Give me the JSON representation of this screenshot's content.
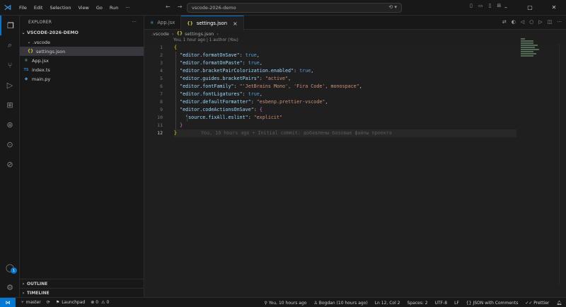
{
  "titlebar": {
    "menu": [
      "File",
      "Edit",
      "Selection",
      "View",
      "Go",
      "Run",
      "···"
    ],
    "search": "vscode-2026-demo"
  },
  "tabs": [
    {
      "icon": "⚛",
      "label": "App.jsx",
      "active": false
    },
    {
      "icon": "{}",
      "label": "settings.json",
      "active": true,
      "close": "×"
    }
  ],
  "breadcrumb": [
    ".vscode",
    "settings.json"
  ],
  "codelens": "You, 1 hour ago | 1 author (You)",
  "sidebar": {
    "title": "EXPLORER",
    "more": "···",
    "root": "VSCODE-2026-DEMO",
    "items": [
      {
        "label": ".vscode",
        "type": "folder",
        "indent": 1
      },
      {
        "label": "settings.json",
        "type": "json",
        "indent": 2,
        "selected": true
      },
      {
        "label": "App.jsx",
        "type": "react",
        "indent": 1
      },
      {
        "label": "index.ts",
        "type": "ts",
        "indent": 1
      },
      {
        "label": "main.py",
        "type": "py",
        "indent": 1
      }
    ],
    "outline": "OUTLINE",
    "timeline": "TIMELINE"
  },
  "editor": {
    "line_numbers": [
      "1",
      "2",
      "3",
      "4",
      "5",
      "6",
      "7",
      "8",
      "9",
      "10",
      "11",
      "12"
    ],
    "current_line": 12,
    "blame": "You, 10 hours ago • Initial commit: добавлены базовые файлы проекта"
  },
  "account_badge": "1",
  "statusbar": {
    "branch": "master",
    "launchpad": "Launchpad",
    "errors": "0",
    "warnings": "0",
    "blame": "You, 10 hours ago",
    "author": "Bogdan (10 hours ago)",
    "position": "Ln 12, Col 2",
    "spaces": "Spaces: 2",
    "encoding": "UTF-8",
    "eol": "LF",
    "language": "JSON with Comments",
    "prettier": "Prettier"
  },
  "colors": {
    "accent": "#0078d4",
    "key": "#9cdcfe",
    "string": "#ce9178",
    "boolean": "#569cd6",
    "bracket": "#ffd700"
  }
}
